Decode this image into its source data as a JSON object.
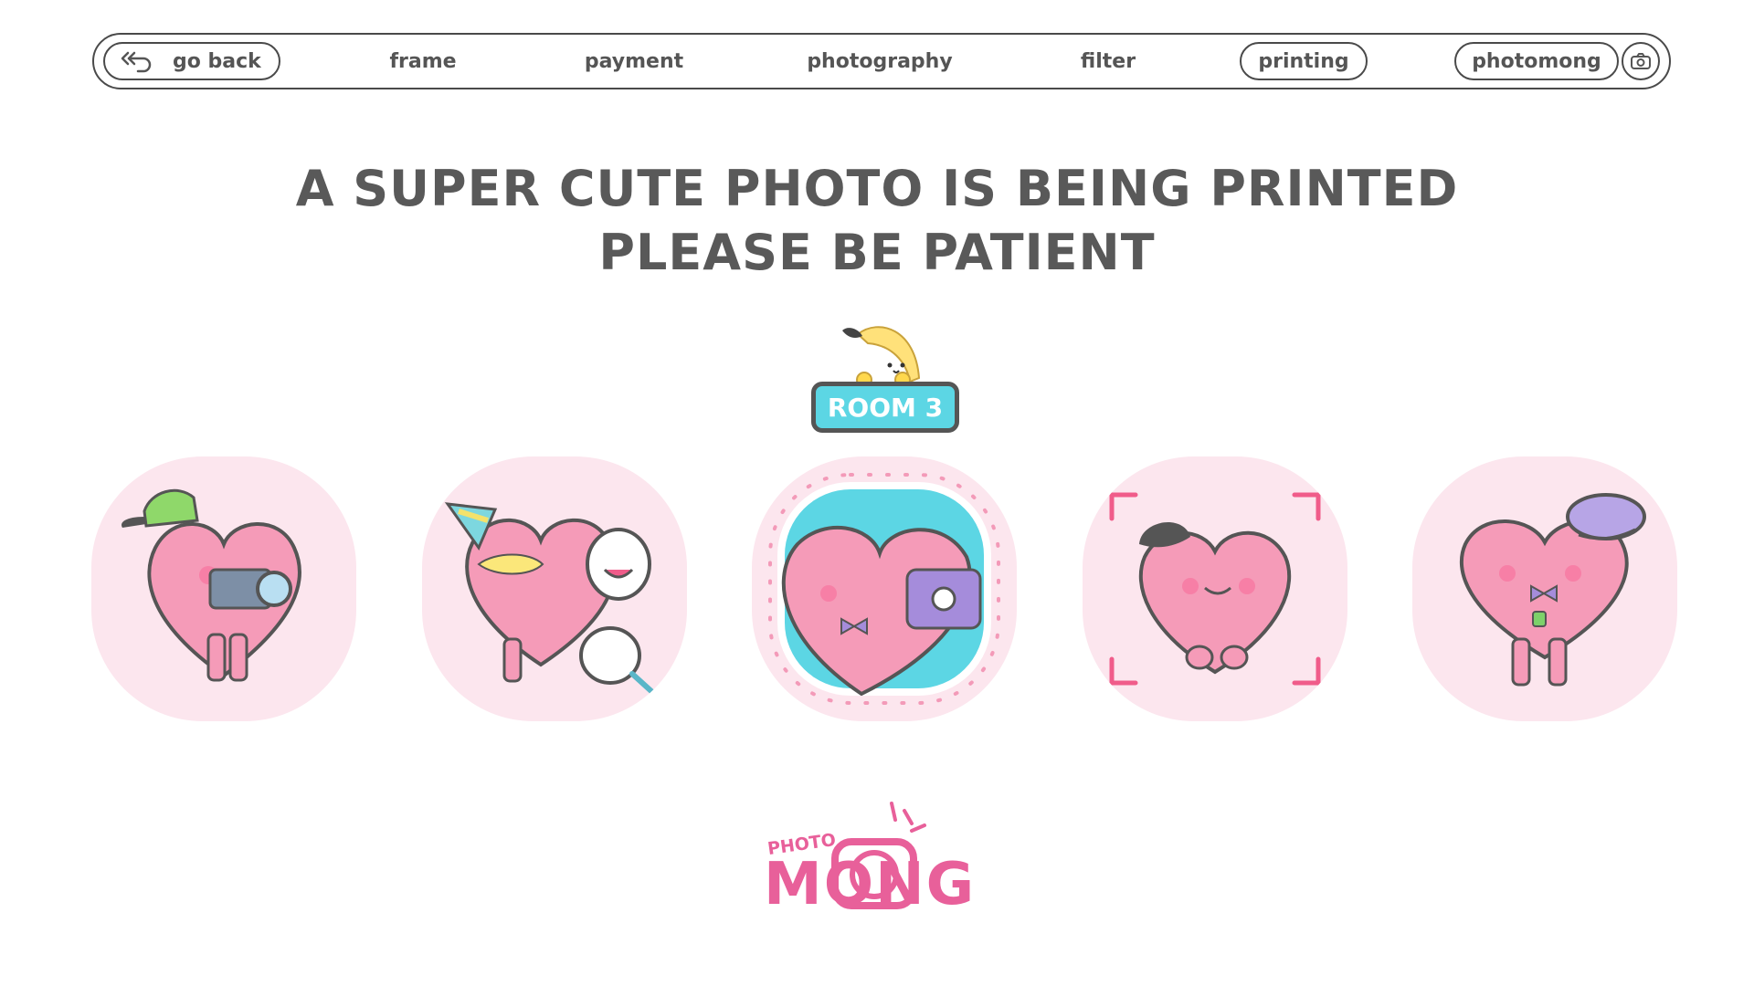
{
  "nav": {
    "back_label": "go back",
    "items": [
      {
        "label": "frame"
      },
      {
        "label": "payment"
      },
      {
        "label": "photography"
      },
      {
        "label": "filter"
      },
      {
        "label": "printing"
      },
      {
        "label": "photomong"
      }
    ],
    "camera_icon": "camera-icon",
    "back_icon": "back-arrow-icon"
  },
  "heading": {
    "line1": "A SUPER CUTE PHOTO IS BEING PRINTED",
    "line2": "PLEASE BE PATIENT"
  },
  "room": {
    "label": "ROOM 3",
    "mascot": "banana-mascot-icon"
  },
  "characters": [
    {
      "name": "heart-with-camera-and-cap"
    },
    {
      "name": "heart-with-party-hat-and-masks"
    },
    {
      "name": "heart-taking-selfie"
    },
    {
      "name": "heart-with-fedora-in-focus-frame"
    },
    {
      "name": "heart-with-beret-and-bowtie"
    }
  ],
  "logo": {
    "small": "PHOTO",
    "big": "MONG"
  },
  "colors": {
    "text": "#595959",
    "border": "#4a4a4a",
    "tile_bg": "#fce6ee",
    "room_badge": "#5cd6e4",
    "brand_pink": "#e8609a"
  }
}
